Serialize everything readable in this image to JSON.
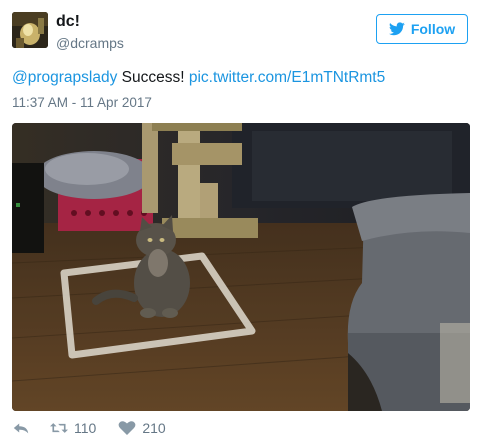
{
  "user": {
    "name": "dc!",
    "handle": "@dcramps"
  },
  "follow_button": {
    "label": "Follow",
    "icon": "twitter-bird-icon"
  },
  "tweet": {
    "mention": "@prograpslady",
    "text": " Success! ",
    "link": "pic.twitter.com/E1mTNtRmt5",
    "timestamp": "11:37 AM - 11 Apr 2017"
  },
  "media": {
    "description_icon": "photo"
  },
  "actions": {
    "retweet_count": "110",
    "like_count": "210"
  },
  "colors": {
    "accent": "#1da1f2",
    "link": "#1b95e0",
    "muted": "#657786"
  }
}
